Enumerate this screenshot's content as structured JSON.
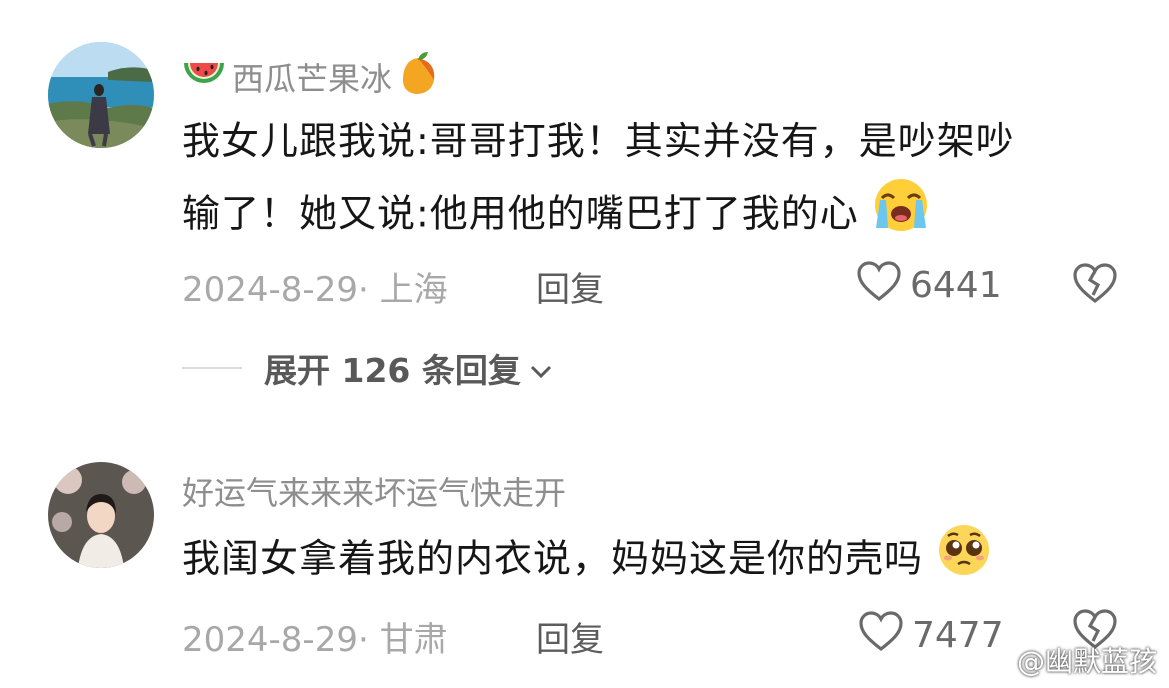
{
  "comments": [
    {
      "username": "西瓜芒果冰",
      "username_prefix_icon": "watermelon-emoji",
      "username_suffix_icon": "mango-emoji",
      "text_line1": "我女儿跟我说:哥哥打我！其实并没有，是吵架吵",
      "text_line2": "输了！她又说:他用他的嘴巴打了我的心",
      "text_emoji": "loudly-crying-face-emoji",
      "date_location": "2024-8-29· 上海",
      "reply_label": "回复",
      "likes": "6441",
      "expand_label": "展开 126 条回复"
    },
    {
      "username": "好运气来来来坏运气快走开",
      "text_line1": "我闺女拿着我的内衣说，妈妈这是你的壳吗",
      "text_emoji": "pleading-face-emoji",
      "date_location": "2024-8-29· 甘肃",
      "reply_label": "回复",
      "likes": "7477"
    }
  ],
  "watermark": {
    "text": "@幽默蓝孩",
    "icon": "weibo-logo-icon"
  },
  "colors": {
    "text": "#161616",
    "meta": "#a8a8a8",
    "username": "#8e8e8e",
    "icon": "#6a6a6a"
  }
}
